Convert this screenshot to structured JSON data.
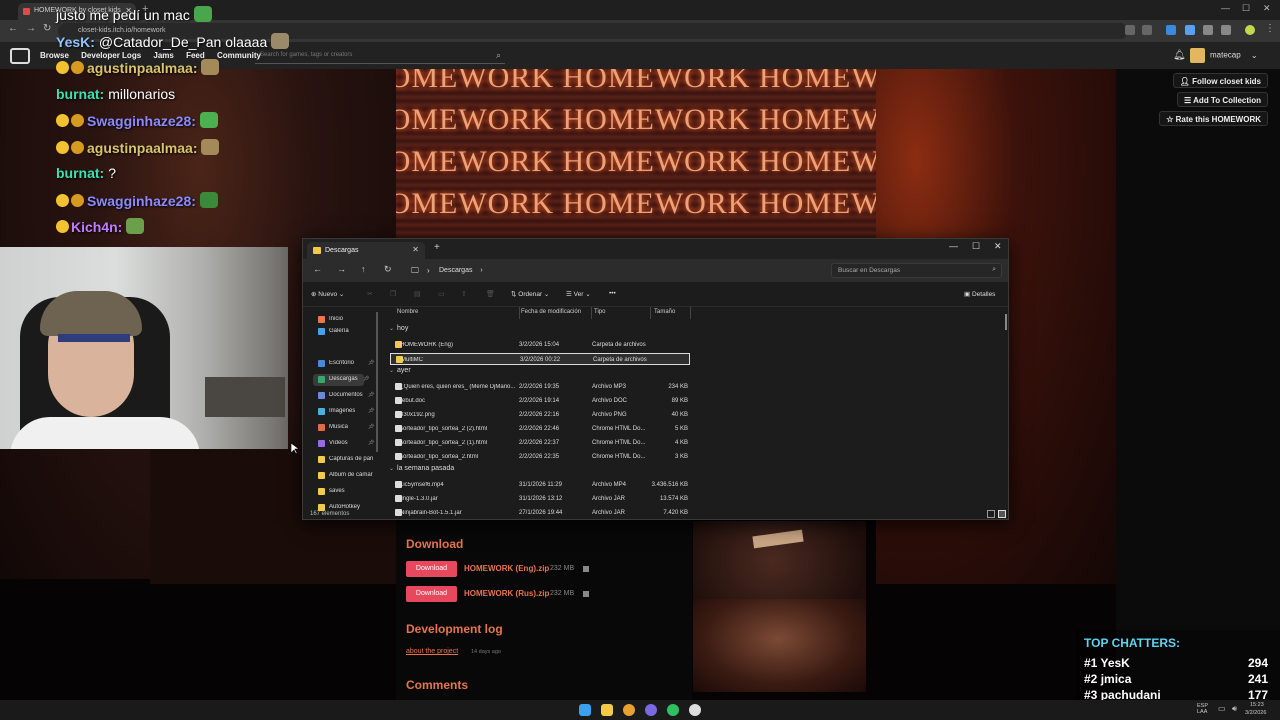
{
  "browser": {
    "tab_title": "HOMEWORK by closet kids",
    "url": "closet-kids.itch.io/homework"
  },
  "itch": {
    "nav": [
      "Browse",
      "Developer Logs",
      "Jams",
      "Feed",
      "Community"
    ],
    "search_placeholder": "Search for games, tags or creators",
    "username": "matecap",
    "actions": {
      "follow": "Follow closet kids",
      "collection": "Add To Collection",
      "rate": "Rate this HOMEWORK"
    },
    "banner_text": "HOMEWORK HOMEWORK HOMEWORK",
    "download_heading": "Download",
    "download_button": "Download",
    "downloads": [
      {
        "name": "HOMEWORK (Eng).zip",
        "size": "232 MB"
      },
      {
        "name": "HOMEWORK (Rus).zip",
        "size": "232 MB"
      }
    ],
    "devlog_heading": "Development log",
    "devlog_link": "about the project",
    "devlog_age": "14 days ago",
    "comments_heading": "Comments"
  },
  "chat": [
    {
      "user": "",
      "text": "justo me pedí un mac",
      "color": "#ffffff",
      "emote": "#49a64a",
      "badges": 0
    },
    {
      "user": "YesK:",
      "text": "@Catador_De_Pan olaaaa",
      "color": "#8fc4ff",
      "emote": "#9a8a6a",
      "badges": 0
    },
    {
      "user": "agustinpaalmaa:",
      "text": "",
      "color": "#d9c46b",
      "emote": "#a38a58",
      "badges": 2
    },
    {
      "user": "burnat:",
      "text": "millonarios",
      "color": "#3fe0b0",
      "emote": "",
      "badges": 0
    },
    {
      "user": "Swagginhaze28:",
      "text": "",
      "color": "#8a8aff",
      "emote": "#4caf50",
      "badges": 2
    },
    {
      "user": "agustinpaalmaa:",
      "text": "",
      "color": "#d9c46b",
      "emote": "#a38a58",
      "badges": 2
    },
    {
      "user": "burnat:",
      "text": "?",
      "color": "#3fe0b0",
      "emote": "",
      "badges": 0
    },
    {
      "user": "Swagginhaze28:",
      "text": "",
      "color": "#8a8aff",
      "emote": "#3a8a3a",
      "badges": 2
    },
    {
      "user": "Kich4n:",
      "text": "",
      "color": "#c07cff",
      "emote": "#6aa04a",
      "badges": 1
    }
  ],
  "explorer": {
    "tab_title": "Descargas",
    "breadcrumb": "Descargas",
    "search_placeholder": "Buscar en Descargas",
    "toolbar": {
      "new": "Nuevo",
      "sort": "Ordenar",
      "view": "Ver",
      "more": "•••",
      "details": "Detalles"
    },
    "sidebar": [
      {
        "label": "Inicio",
        "color": "#e8784a",
        "pinned": false
      },
      {
        "label": "Galería",
        "color": "#4aa0e8",
        "pinned": false
      },
      {
        "label": "Escritorio",
        "color": "#4a88d8",
        "pinned": true
      },
      {
        "label": "Descargas",
        "color": "#3aa76a",
        "pinned": true,
        "selected": true
      },
      {
        "label": "Documentos",
        "color": "#6a8ad8",
        "pinned": true
      },
      {
        "label": "Imágenes",
        "color": "#4ab0e0",
        "pinned": true
      },
      {
        "label": "Música",
        "color": "#e06a4a",
        "pinned": true
      },
      {
        "label": "Vídeos",
        "color": "#9a6ae0",
        "pinned": true
      },
      {
        "label": "Capturas de pantalla",
        "color": "#f3c94b",
        "pinned": false
      },
      {
        "label": "Álbum de cámara",
        "color": "#f3c94b",
        "pinned": false
      },
      {
        "label": "saves",
        "color": "#f3c94b",
        "pinned": false
      },
      {
        "label": "AutoHotkey",
        "color": "#f3c94b",
        "pinned": false
      }
    ],
    "columns": [
      "Nombre",
      "Fecha de modificación",
      "Tipo",
      "Tamaño"
    ],
    "groups": [
      {
        "label": "hoy",
        "files": [
          {
            "name": "HOMEWORK (Eng)",
            "date": "3/2/2026 15:04",
            "type": "Carpeta de archivos",
            "size": "",
            "icon": "#f3c94b"
          },
          {
            "name": "MultiMC",
            "date": "3/2/2026 00:22",
            "type": "Carpeta de archivos",
            "size": "",
            "icon": "#f3c94b",
            "selected": true
          }
        ]
      },
      {
        "label": "ayer",
        "files": [
          {
            "name": "¿Quien eres, quien eres_ (Meme DjMario...",
            "date": "2/2/2026 19:35",
            "type": "Archivo MP3",
            "size": "234 KB",
            "icon": "#dddddd"
          },
          {
            "name": "rebut.doc",
            "date": "2/2/2026 19:14",
            "type": "Archivo DOC",
            "size": "89 KB",
            "icon": "#dddddd"
          },
          {
            "name": "330x192.png",
            "date": "2/2/2026 22:16",
            "type": "Archivo PNG",
            "size": "40 KB",
            "icon": "#dddddd"
          },
          {
            "name": "sorteador_tipo_sortea_2 (2).html",
            "date": "2/2/2026 22:46",
            "type": "Chrome HTML Do...",
            "size": "5 KB",
            "icon": "#dddddd"
          },
          {
            "name": "sorteador_tipo_sortea_2 (1).html",
            "date": "2/2/2026 22:37",
            "type": "Chrome HTML Do...",
            "size": "4 KB",
            "icon": "#dddddd"
          },
          {
            "name": "sorteador_tipo_sortea_2.html",
            "date": "2/2/2026 22:35",
            "type": "Chrome HTML Do...",
            "size": "3 KB",
            "icon": "#dddddd"
          }
        ]
      },
      {
        "label": "la semana pasada",
        "files": [
          {
            "name": "1ic5ymsef6.mp4",
            "date": "31/1/2026 11:29",
            "type": "Archivo MP4",
            "size": "3.436.516 KB",
            "icon": "#dddddd"
          },
          {
            "name": "jingle-1.3.0.jar",
            "date": "31/1/2026 13:12",
            "type": "Archivo JAR",
            "size": "13.574 KB",
            "icon": "#dddddd"
          },
          {
            "name": "Ninjabrain-Bot-1.5.1.jar",
            "date": "27/1/2026 19:44",
            "type": "Archivo JAR",
            "size": "7.420 KB",
            "icon": "#dddddd"
          }
        ]
      }
    ],
    "status": "167 elementos"
  },
  "top_chatters": {
    "title": "TOP CHATTERS:",
    "rows": [
      {
        "rank": "#1",
        "name": "YesK",
        "count": "294"
      },
      {
        "rank": "#2",
        "name": "jmica",
        "count": "241"
      },
      {
        "rank": "#3",
        "name": "pachudani",
        "count": "177"
      }
    ]
  },
  "taskbar": {
    "lang": "ESP\nLAA",
    "time": "15:23",
    "date": "3/2/2026",
    "apps": [
      {
        "name": "windows-start",
        "color": "#3aa0f0"
      },
      {
        "name": "file-explorer",
        "color": "#f3c94b"
      },
      {
        "name": "chrome",
        "color": "#e8a030"
      },
      {
        "name": "discord",
        "color": "#7a6ae0"
      },
      {
        "name": "spotify",
        "color": "#2ec060"
      },
      {
        "name": "obs",
        "color": "#dddddd"
      }
    ]
  }
}
